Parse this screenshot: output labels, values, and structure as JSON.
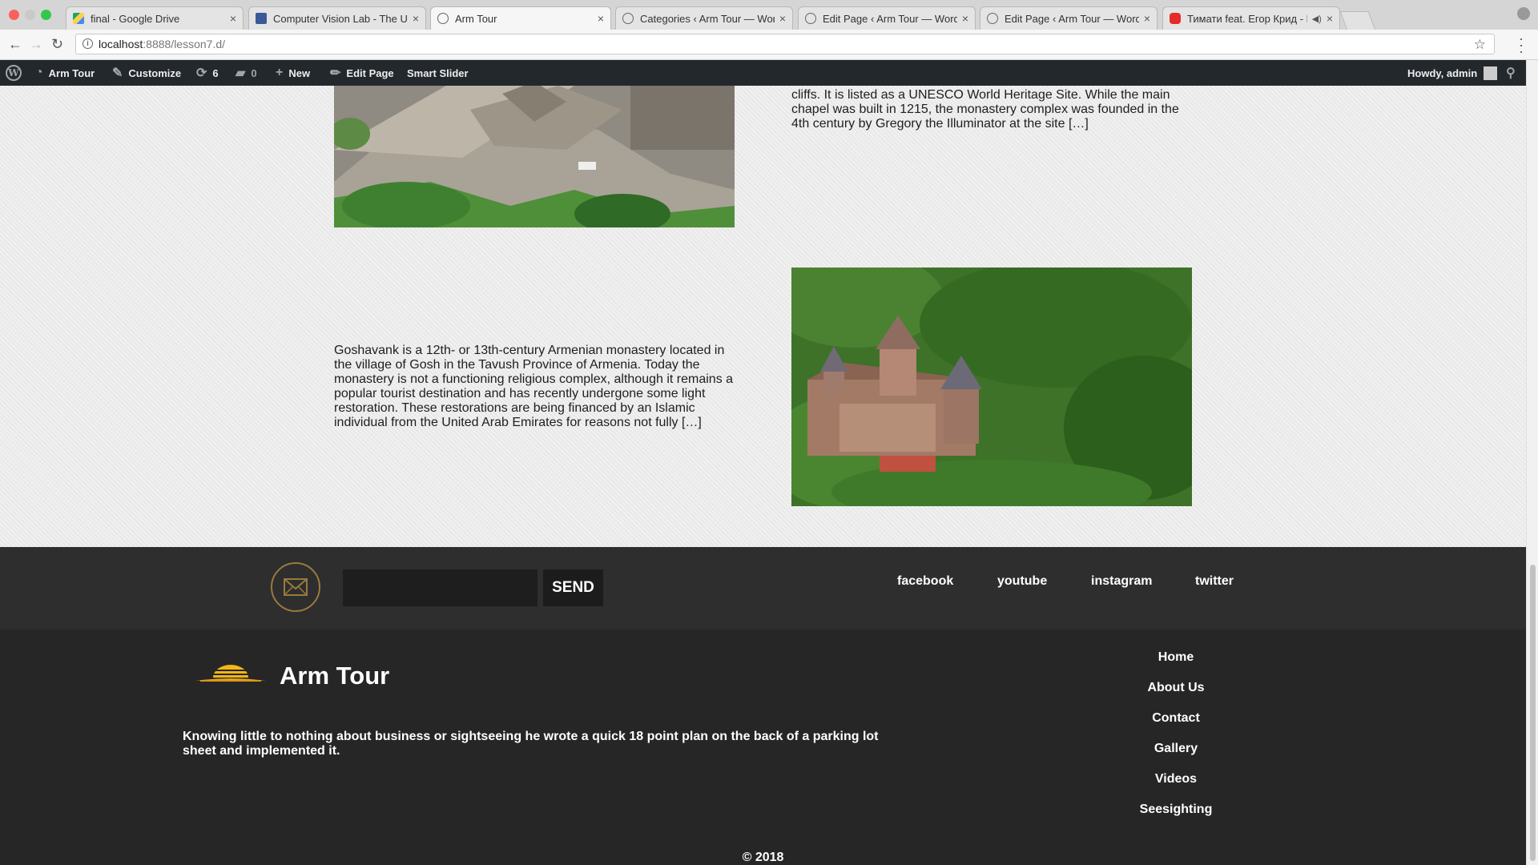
{
  "browser": {
    "tabs": [
      {
        "title": "final - Google Drive",
        "favicon": "drive-icon"
      },
      {
        "title": "Computer Vision Lab - The Un",
        "favicon": "facebook-icon"
      },
      {
        "title": "Arm Tour",
        "favicon": "wordpress-icon",
        "active": true
      },
      {
        "title": "Categories ‹ Arm Tour — Word",
        "favicon": "wordpress-icon"
      },
      {
        "title": "Edit Page ‹ Arm Tour — WordP",
        "favicon": "wordpress-icon"
      },
      {
        "title": "Edit Page ‹ Arm Tour — WordP",
        "favicon": "wordpress-icon"
      },
      {
        "title": "Тимати feat. Егор Крид - П",
        "favicon": "youtube-icon"
      }
    ],
    "url_host": "localhost",
    "url_rest": ":8888/lesson7.d/"
  },
  "adminbar": {
    "site": "Arm Tour",
    "customize": "Customize",
    "updates": "6",
    "comments": "0",
    "new": "New",
    "edit_page": "Edit Page",
    "smart_slider": "Smart Slider",
    "howdy": "Howdy, admin"
  },
  "posts": {
    "geghard_excerpt": "cliffs. It is listed as a UNESCO World Heritage Site. While the main chapel was built in 1215, the monastery complex was founded in the 4th century by Gregory the Illuminator at the site […]",
    "goshavank_excerpt": "Goshavank is a 12th- or 13th-century Armenian monastery located in the village of Gosh in the Tavush Province of Armenia. Today the monastery is not a functioning religious complex, although it remains a popular tourist destination and has recently undergone some light restoration. These restorations are being financed by an Islamic individual from the United Arab Emirates for reasons not fully […]"
  },
  "newsletter": {
    "send": "SEND"
  },
  "social": {
    "facebook": "facebook",
    "youtube": "youtube",
    "instagram": "instagram",
    "twitter": "twitter"
  },
  "footer": {
    "brand": "Arm Tour",
    "tagline": "Knowing little to nothing about business or sightseeing he wrote a quick 18 point plan on the back of a parking lot sheet and implemented it.",
    "nav": [
      "Home",
      "About Us",
      "Contact",
      "Gallery",
      "Videos",
      "Seesighting"
    ],
    "copyright": "© 2018"
  },
  "colors": {
    "footer_bg": "#262626",
    "strip_bg": "#2e2e2e",
    "adminbar_bg": "#23282d",
    "accent_gold": "#9a7a3c"
  }
}
